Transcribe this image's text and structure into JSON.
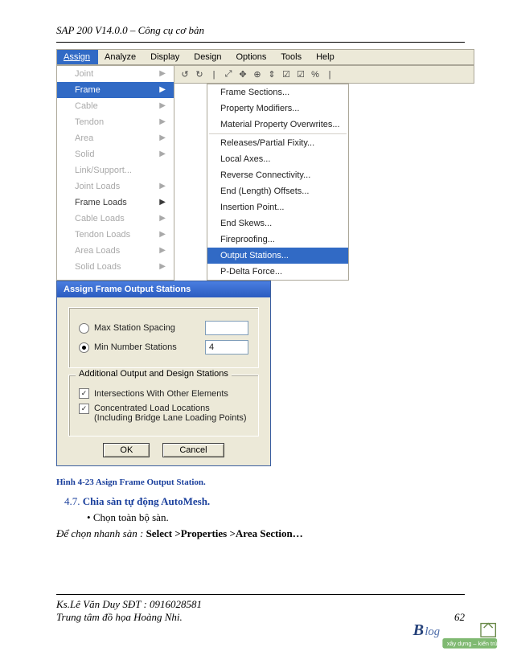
{
  "header": "SAP 200 V14.0.0 – Công cụ cơ bản",
  "menubar": [
    "Assign",
    "Analyze",
    "Display",
    "Design",
    "Options",
    "Tools",
    "Help"
  ],
  "submenu": [
    {
      "label": "Joint",
      "arrow": true,
      "gray": true
    },
    {
      "label": "Frame",
      "arrow": true,
      "hl": true
    },
    {
      "label": "Cable",
      "arrow": true,
      "gray": true
    },
    {
      "label": "Tendon",
      "arrow": true,
      "gray": true
    },
    {
      "label": "Area",
      "arrow": true,
      "gray": true
    },
    {
      "label": "Solid",
      "arrow": true,
      "gray": true
    },
    {
      "label": "Link/Support...",
      "gray": true
    },
    {
      "label": "Joint Loads",
      "arrow": true,
      "gray": true
    },
    {
      "label": "Frame Loads",
      "arrow": true
    },
    {
      "label": "Cable Loads",
      "arrow": true,
      "gray": true
    },
    {
      "label": "Tendon Loads",
      "arrow": true,
      "gray": true
    },
    {
      "label": "Area Loads",
      "arrow": true,
      "gray": true
    },
    {
      "label": "Solid Loads",
      "arrow": true,
      "gray": true
    }
  ],
  "toolbar_icons": [
    "↺",
    "↻",
    "|",
    "⤢",
    "✥",
    "⊕",
    "⇕",
    "☑",
    "☑",
    "%",
    "|"
  ],
  "flyout": [
    {
      "label": "Frame Sections..."
    },
    {
      "label": "Property Modifiers..."
    },
    {
      "label": "Material Property Overwrites..."
    },
    {
      "sep": true
    },
    {
      "label": "Releases/Partial Fixity..."
    },
    {
      "label": "Local Axes..."
    },
    {
      "label": "Reverse Connectivity..."
    },
    {
      "label": "End (Length) Offsets..."
    },
    {
      "label": "Insertion Point..."
    },
    {
      "label": "End Skews..."
    },
    {
      "label": "Fireproofing..."
    },
    {
      "label": "Output Stations...",
      "hl": true
    },
    {
      "label": "P-Delta Force..."
    }
  ],
  "dialog": {
    "title": "Assign Frame Output Stations",
    "radio1": "Max Station Spacing",
    "radio2": "Min Number Stations",
    "value": "4",
    "group_label": "Additional Output and Design Stations",
    "chk1": "Intersections With Other Elements",
    "chk2": "Concentrated Load Locations\n(Including Bridge Lane Loading Points)",
    "ok": "OK",
    "cancel": "Cancel"
  },
  "caption": "Hình 4-23 Asign Frame Output Station.",
  "section": {
    "num": "4.7.",
    "title": "Chia sàn tự động AutoMesh."
  },
  "bullet": "Chọn toàn bộ sàn.",
  "tip_lead": "Để chọn nhanh sàn : ",
  "tip_bold": "Select >Properties >Area Section…",
  "footer": {
    "l1": "Ks.Lê Văn Duy SĐT : 0916028581",
    "l2": "Trung tâm đồ họa Hoàng Nhi.",
    "page": "62"
  },
  "logo": {
    "brand": "Blog",
    "tag": "xây dựng – kiến trúc",
    "house": "⌂"
  }
}
